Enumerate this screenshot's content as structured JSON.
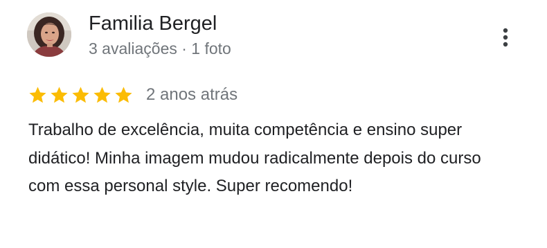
{
  "review": {
    "reviewer_name": "Familia Bergel",
    "reviewer_meta": "3 avaliações · 1 foto",
    "rating": 5,
    "rating_max": 5,
    "date": "2 anos atrás",
    "text": "Trabalho de excelência, muita competência e ensino super didático! Minha imagem mudou radicalmente depois do curso com essa personal style. Super recomendo!"
  },
  "icons": {
    "more": "more-vert-icon",
    "star": "star-icon",
    "avatar": "avatar-photo"
  },
  "colors": {
    "star": "#fbbc04",
    "name": "#202124",
    "meta": "#70757a",
    "body_text": "#202124"
  }
}
